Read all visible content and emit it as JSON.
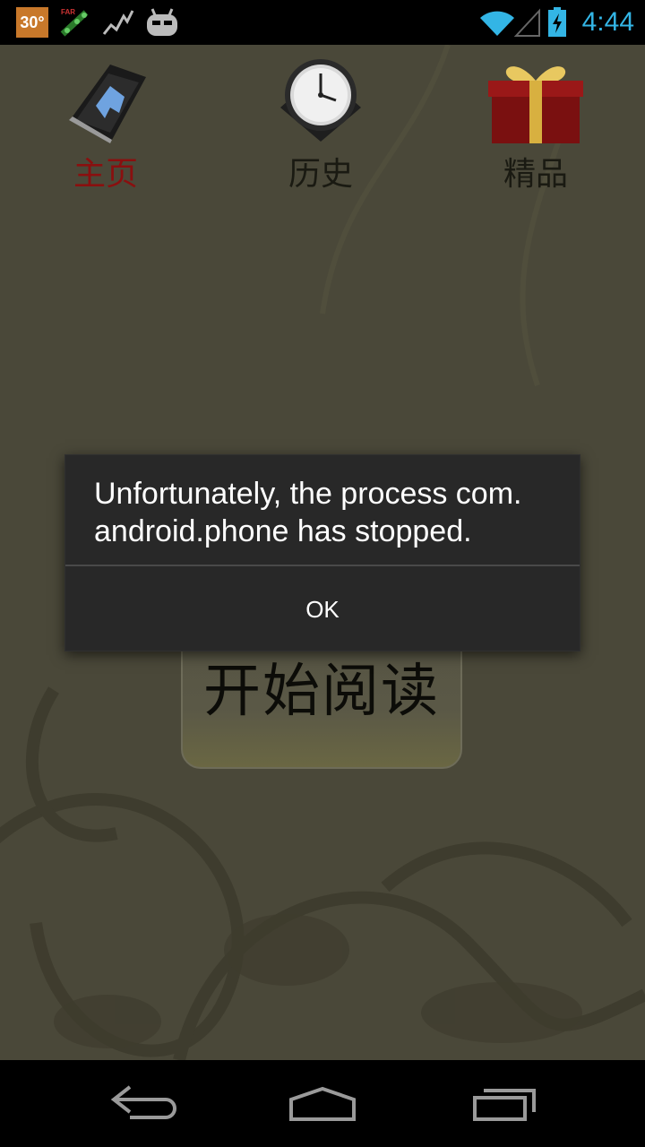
{
  "status_bar": {
    "temperature": "30°",
    "time": "4:44",
    "icons": [
      "weather-temp-icon",
      "flag-icon",
      "activity-icon",
      "cyanogen-icon",
      "wifi-icon",
      "signal-icon",
      "battery-charging-icon"
    ]
  },
  "tabs": [
    {
      "label": "主页",
      "icon": "home-book-icon",
      "active": true
    },
    {
      "label": "历史",
      "icon": "clock-icon",
      "active": false
    },
    {
      "label": "精品",
      "icon": "gift-icon",
      "active": false
    }
  ],
  "start_button": {
    "label": "开始阅读"
  },
  "dialog": {
    "message": "Unfortunately, the process com. android.phone has stopped.",
    "ok_label": "OK"
  },
  "nav_bar": {
    "icons": [
      "back-icon",
      "home-icon",
      "recent-apps-icon"
    ]
  },
  "colors": {
    "clock": "#33b5e5",
    "active_tab": "#8a0f0f",
    "dialog_bg": "#282828",
    "app_bg": "#4a4839"
  }
}
